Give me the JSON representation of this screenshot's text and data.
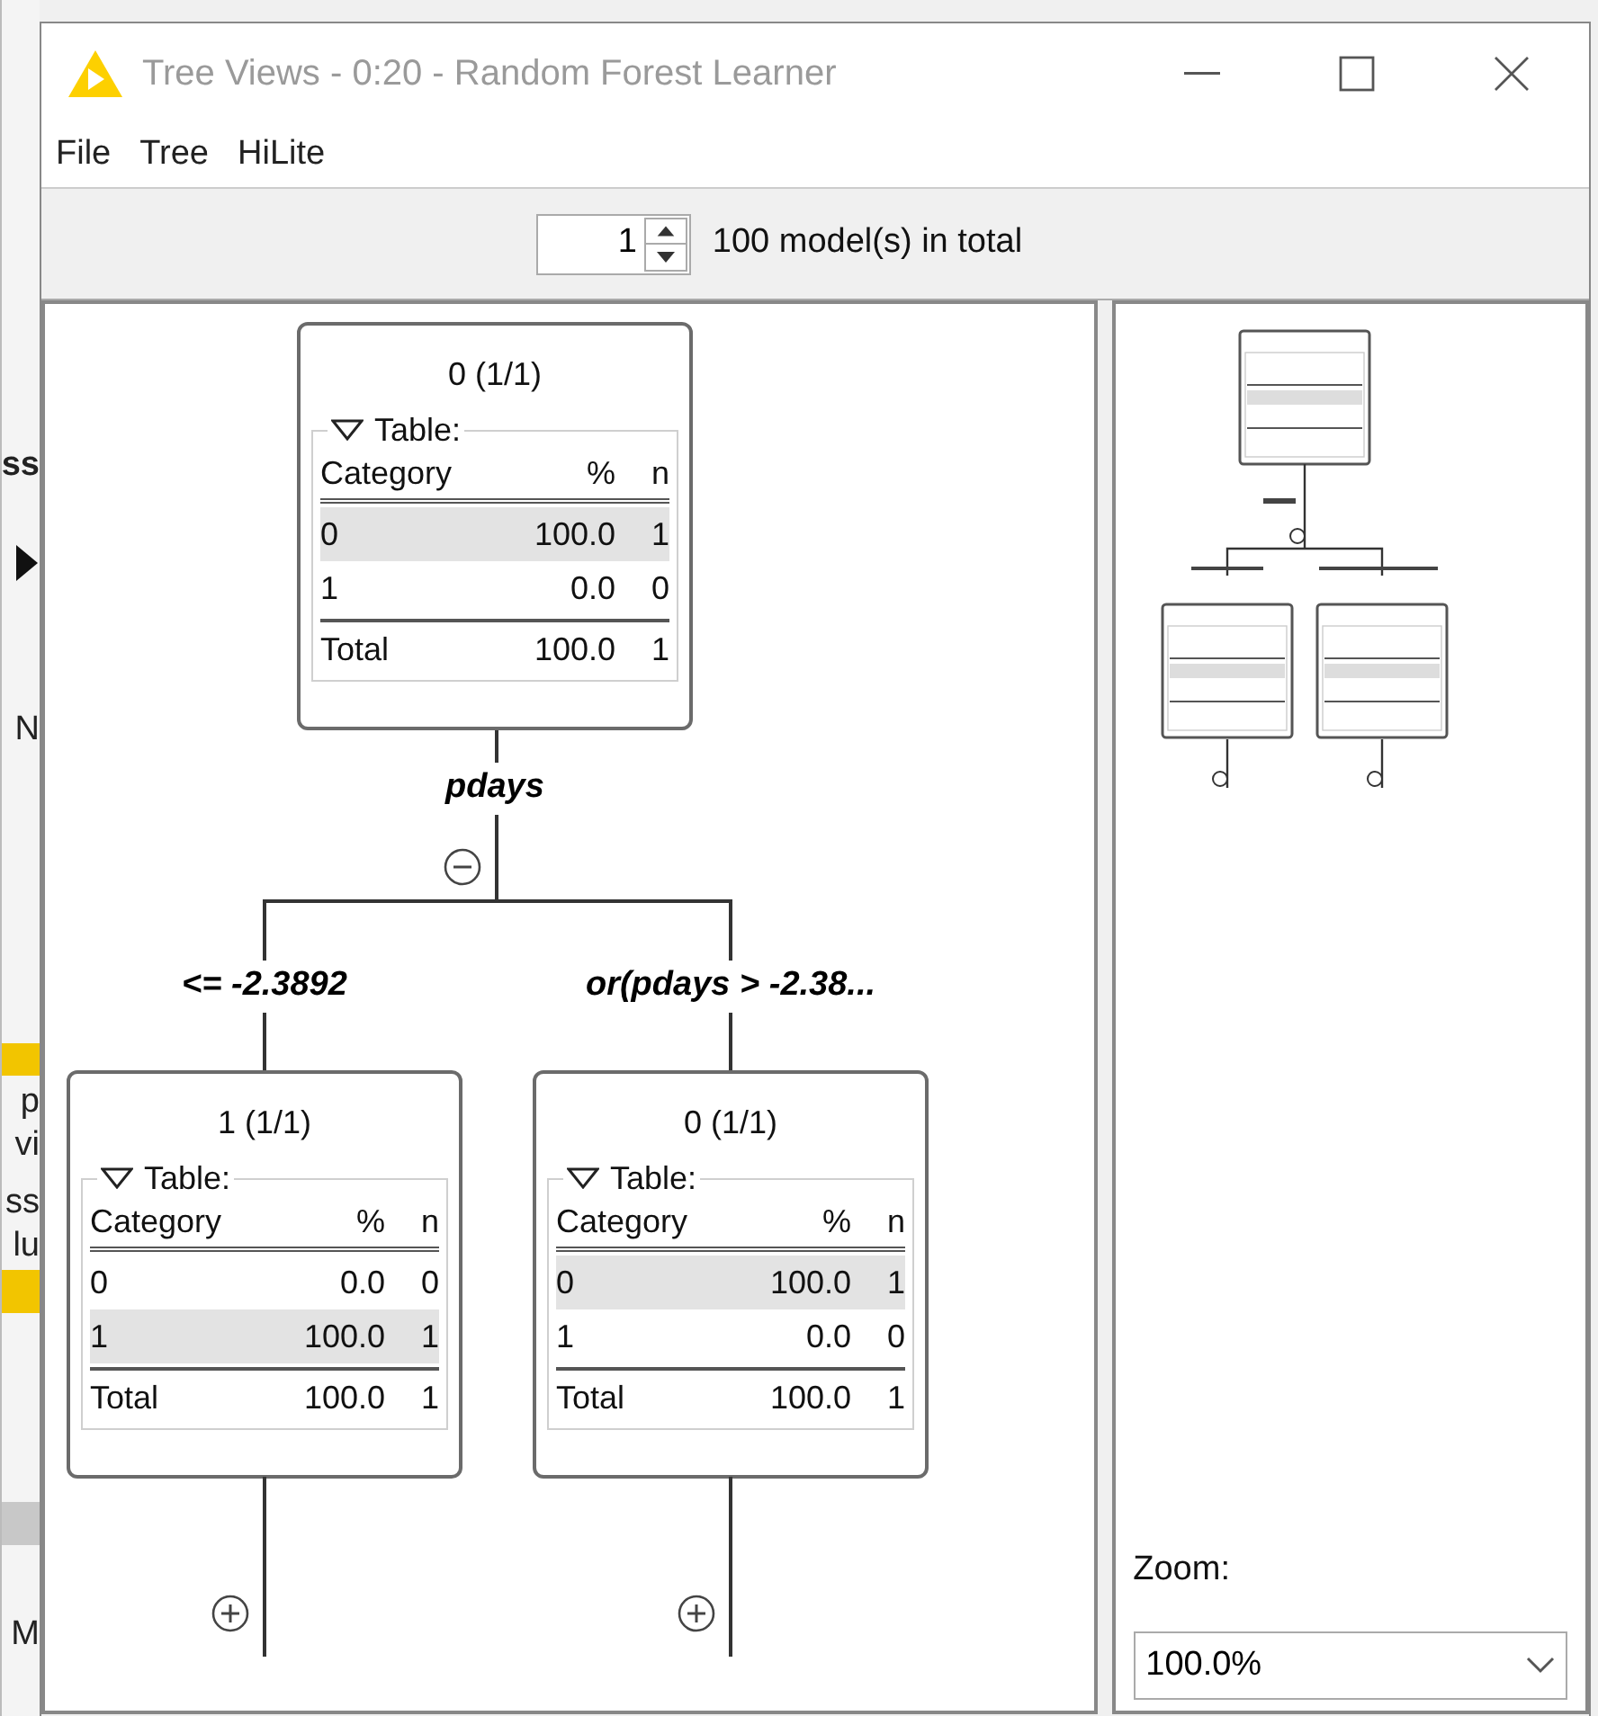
{
  "background_fragments": [
    "ss",
    "N",
    "p",
    "vi",
    "ss",
    "lu",
    "M"
  ],
  "window": {
    "title": "Tree Views - 0:20 - Random Forest Learner"
  },
  "menu": [
    "File",
    "Tree",
    "HiLite"
  ],
  "toolbar": {
    "model_index": "1",
    "total_label": "100 model(s) in total"
  },
  "tree": {
    "title": "0 (1/1)",
    "table": {
      "label": "Table:",
      "expanded": true,
      "columns": [
        "Category",
        "%",
        "n"
      ],
      "rows": [
        {
          "cells": [
            "0",
            "100.0",
            "1"
          ],
          "highlighted": true
        },
        {
          "cells": [
            "1",
            "0.0",
            "0"
          ],
          "highlighted": false
        }
      ],
      "total": [
        "Total",
        "100.0",
        "1"
      ]
    },
    "split": "pdays",
    "expanded": true,
    "children": [
      {
        "condition": "<= -2.3892",
        "title": "1 (1/1)",
        "expanded": false,
        "table": {
          "label": "Table:",
          "expanded": true,
          "columns": [
            "Category",
            "%",
            "n"
          ],
          "rows": [
            {
              "cells": [
                "0",
                "0.0",
                "0"
              ],
              "highlighted": false
            },
            {
              "cells": [
                "1",
                "100.0",
                "1"
              ],
              "highlighted": true
            }
          ],
          "total": [
            "Total",
            "100.0",
            "1"
          ]
        }
      },
      {
        "condition": "or(pdays > -2.38...",
        "title": "0 (1/1)",
        "expanded": false,
        "table": {
          "label": "Table:",
          "expanded": true,
          "columns": [
            "Category",
            "%",
            "n"
          ],
          "rows": [
            {
              "cells": [
                "0",
                "100.0",
                "1"
              ],
              "highlighted": true
            },
            {
              "cells": [
                "1",
                "0.0",
                "0"
              ],
              "highlighted": false
            }
          ],
          "total": [
            "Total",
            "100.0",
            "1"
          ]
        }
      }
    ]
  },
  "overview": {
    "zoom_label": "Zoom:",
    "zoom_value": "100.0%"
  }
}
